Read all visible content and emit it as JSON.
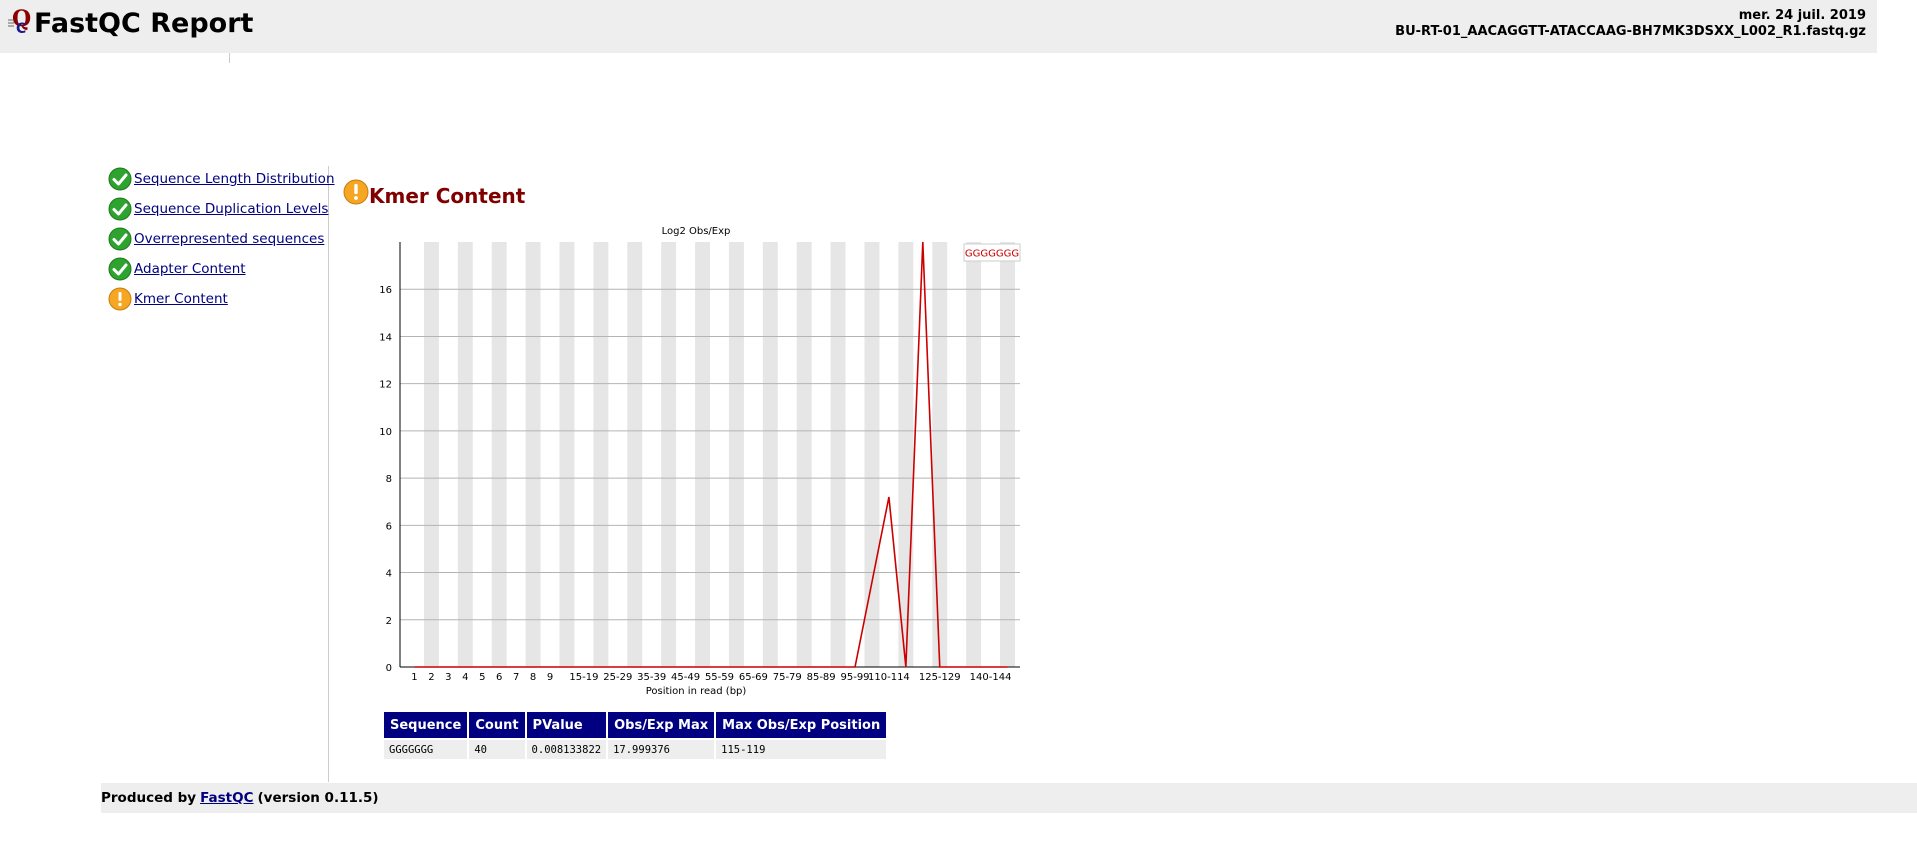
{
  "header": {
    "title": "FastQC Report",
    "date": "mer. 24 juil. 2019",
    "filename": "BU-RT-01_AACAGGTT-ATACCAAG-BH7MK3DSXX_L002_R1.fastq.gz"
  },
  "sidebar": {
    "items": [
      {
        "label": "Sequence Length Distribution",
        "status": "pass"
      },
      {
        "label": "Sequence Duplication Levels",
        "status": "pass"
      },
      {
        "label": "Overrepresented sequences",
        "status": "pass"
      },
      {
        "label": "Adapter Content",
        "status": "pass"
      },
      {
        "label": "Kmer Content",
        "status": "warn"
      }
    ]
  },
  "module": {
    "title": "Kmer Content",
    "status": "warn"
  },
  "colors": {
    "pass": "#2fa32f",
    "warn": "#f5a623",
    "link": "#000080",
    "title": "#800000",
    "line": "#cc0000",
    "stripe": "#e6e6e6"
  },
  "chart_data": {
    "type": "line",
    "title": "Log2 Obs/Exp",
    "xlabel": "Position in read (bp)",
    "ylabel": "",
    "categories": [
      "1",
      "2",
      "3",
      "4",
      "5",
      "6",
      "7",
      "8",
      "9",
      "10-14",
      "15-19",
      "20-24",
      "25-29",
      "30-34",
      "35-39",
      "40-44",
      "45-49",
      "50-54",
      "55-59",
      "60-64",
      "65-69",
      "70-74",
      "75-79",
      "80-84",
      "85-89",
      "90-94",
      "95-99",
      "100-104",
      "105-109",
      "110-114",
      "115-119",
      "120-124",
      "125-129",
      "130-134",
      "135-139",
      "140-144"
    ],
    "tick_labels": [
      "1",
      "2",
      "3",
      "4",
      "5",
      "6",
      "7",
      "8",
      "9",
      "",
      "15-19",
      "",
      "25-29",
      "",
      "35-39",
      "",
      "45-49",
      "",
      "55-59",
      "",
      "65-69",
      "",
      "75-79",
      "",
      "85-89",
      "",
      "95-99",
      "",
      "110-114",
      "",
      "",
      "125-129",
      "",
      "",
      "140-144",
      ""
    ],
    "ylim": [
      0,
      18
    ],
    "yticks": [
      0,
      2,
      4,
      6,
      8,
      10,
      12,
      14,
      16
    ],
    "grid": true,
    "legend": "top-right",
    "series": [
      {
        "name": "GGGGGGG",
        "values": [
          0,
          0,
          0,
          0,
          0,
          0,
          0,
          0,
          0,
          0,
          0,
          0,
          0,
          0,
          0,
          0,
          0,
          0,
          0,
          0,
          0,
          0,
          0,
          0,
          0,
          0,
          0,
          3.6,
          7.2,
          0,
          18.0,
          0,
          0,
          0,
          0,
          0
        ]
      }
    ]
  },
  "table": {
    "headers": [
      "Sequence",
      "Count",
      "PValue",
      "Obs/Exp Max",
      "Max Obs/Exp Position"
    ],
    "rows": [
      [
        "GGGGGGG",
        "40",
        "0.008133822",
        "17.999376",
        "115-119"
      ]
    ]
  },
  "footer": {
    "prefix": "Produced by",
    "link": "FastQC",
    "suffix": "(version 0.11.5)"
  }
}
